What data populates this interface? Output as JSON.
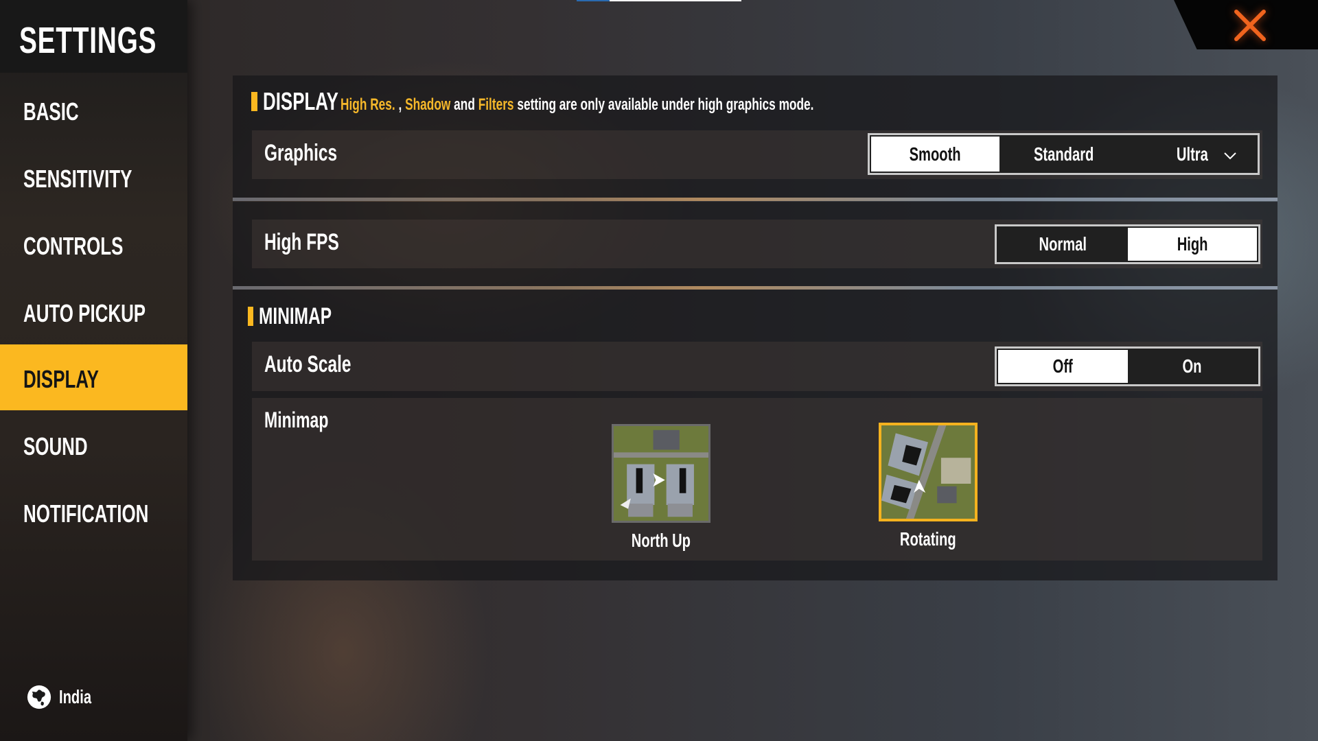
{
  "top_progress": {
    "fraction": 0.2
  },
  "sidebar": {
    "title": "SETTINGS",
    "items": [
      {
        "label": "BASIC",
        "active": false
      },
      {
        "label": "SENSITIVITY",
        "active": false
      },
      {
        "label": "CONTROLS",
        "active": false
      },
      {
        "label": "AUTO PICKUP",
        "active": false
      },
      {
        "label": "DISPLAY",
        "active": true
      },
      {
        "label": "SOUND",
        "active": false
      },
      {
        "label": "NOTIFICATION",
        "active": false
      }
    ],
    "region": {
      "icon": "globe-icon",
      "label": "India"
    }
  },
  "close": {
    "icon": "close-icon"
  },
  "display": {
    "title": "DISPLAY",
    "note": {
      "hl1": "High Res.",
      "sep1": " , ",
      "hl2": "Shadow",
      "mid": " and ",
      "hl3": "Filters",
      "rest": " setting are only available under high graphics mode."
    },
    "graphics": {
      "label": "Graphics",
      "options": [
        "Smooth",
        "Standard",
        "Ultra"
      ],
      "selected": "Smooth",
      "dropdown_icon": "chevron-down-icon"
    },
    "high_fps": {
      "label": "High FPS",
      "options": [
        "Normal",
        "High"
      ],
      "selected": "High"
    }
  },
  "minimap": {
    "title": "MINIMAP",
    "auto_scale": {
      "label": "Auto Scale",
      "options": [
        "Off",
        "On"
      ],
      "selected": "Off"
    },
    "mode": {
      "label": "Minimap",
      "options": [
        {
          "label": "North Up",
          "selected": false
        },
        {
          "label": "Rotating",
          "selected": true
        }
      ]
    }
  },
  "colors": {
    "accent": "#fbb820",
    "highlight_text": "#f5b72a",
    "close": "#f0641e"
  }
}
